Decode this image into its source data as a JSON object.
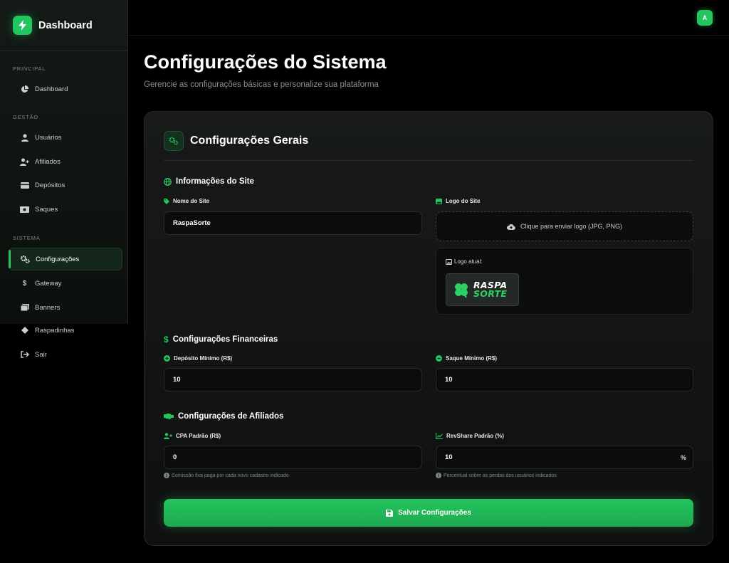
{
  "sidebar": {
    "brand": "Dashboard",
    "sections": {
      "principal": "PRINCIPAL",
      "gestao": "GESTÃO",
      "sistema": "SISTEMA"
    },
    "items": {
      "dashboard": "Dashboard",
      "usuarios": "Usuários",
      "afiliados": "Afiliados",
      "depositos": "Depósitos",
      "saques": "Saques",
      "configuracoes": "Configurações",
      "gateway": "Gateway",
      "banners": "Banners",
      "raspadinhas": "Raspadinhas",
      "sair": "Sair"
    },
    "active": "configuracoes"
  },
  "topbar": {
    "avatar": "A"
  },
  "page": {
    "title": "Configurações do Sistema",
    "subtitle": "Gerencie as configurações básicas e personalize sua plataforma"
  },
  "card": {
    "title": "Configurações Gerais"
  },
  "site_info": {
    "title": "Informações do Site",
    "name_label": "Nome do Site",
    "name_value": "RaspaSorte",
    "logo_label": "Logo do Site",
    "upload_text": "Clique para enviar logo (JPG, PNG)",
    "current_logo_label": "Logo atual:",
    "logo_line1": "RASPA",
    "logo_line2": "SORTE"
  },
  "financial": {
    "title": "Configurações Financeiras",
    "deposit_label": "Depósito Mínimo (R$)",
    "deposit_value": "10",
    "withdraw_label": "Saque Mínimo (R$)",
    "withdraw_value": "10"
  },
  "affiliates": {
    "title": "Configurações de Afiliados",
    "cpa_label": "CPA Padrão (R$)",
    "cpa_value": "0",
    "cpa_hint": "Comissão fixa paga por cada novo cadastro indicado",
    "revshare_label": "RevShare Padrão (%)",
    "revshare_value": "10",
    "revshare_suffix": "%",
    "revshare_hint": "Percentual sobre as perdas dos usuários indicados"
  },
  "save_button": "Salvar Configurações",
  "colors": {
    "accent": "#22c55e",
    "background": "#000000",
    "card": "#151816"
  }
}
